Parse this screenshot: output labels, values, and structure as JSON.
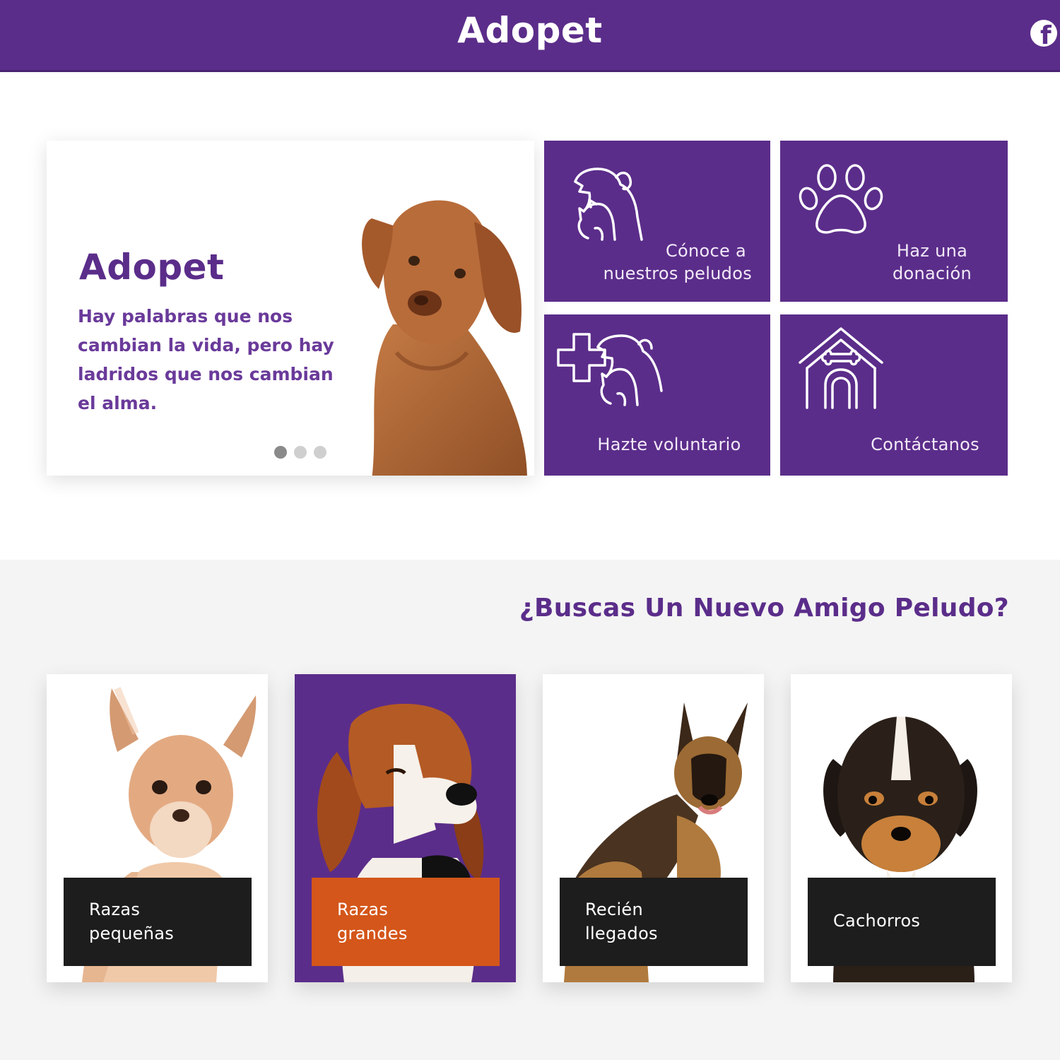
{
  "header": {
    "brand": "Adopet",
    "social_icon": "facebook-icon",
    "social_glyph": "f"
  },
  "colors": {
    "primary": "#5b2d8a",
    "accent": "#d4561a",
    "caption_dark": "#1d1d1d",
    "section_bg": "#f4f4f4"
  },
  "hero": {
    "title": "Adopet",
    "text": "Hay palabras que nos cambian la vida,  pero hay ladridos que nos cambian el alma.",
    "slides": 3,
    "active_slide": 1
  },
  "tiles": [
    {
      "label_1": "Cónoce a",
      "label_2": "nuestros peludos",
      "icon": "dog-cat-icon"
    },
    {
      "label_1": "Haz una",
      "label_2": "donación",
      "icon": "paw-icon"
    },
    {
      "label_1": "Hazte voluntario",
      "icon": "medical-pets-icon"
    },
    {
      "label_1": "Contáctanos",
      "icon": "dog-house-icon"
    }
  ],
  "adopt": {
    "title": "¿Buscas Un Nuevo Amigo Peludo?",
    "cards": [
      {
        "line_1": "Razas",
        "line_2": "pequeñas",
        "image": "chihuahua-photo"
      },
      {
        "line_1": "Razas",
        "line_2": "grandes",
        "image": "beagle-photo",
        "highlighted": true
      },
      {
        "line_1": "Recién",
        "line_2": "llegados",
        "image": "german-shepherd-photo"
      },
      {
        "line_1": "Cachorros",
        "image": "puppy-photo"
      }
    ]
  }
}
